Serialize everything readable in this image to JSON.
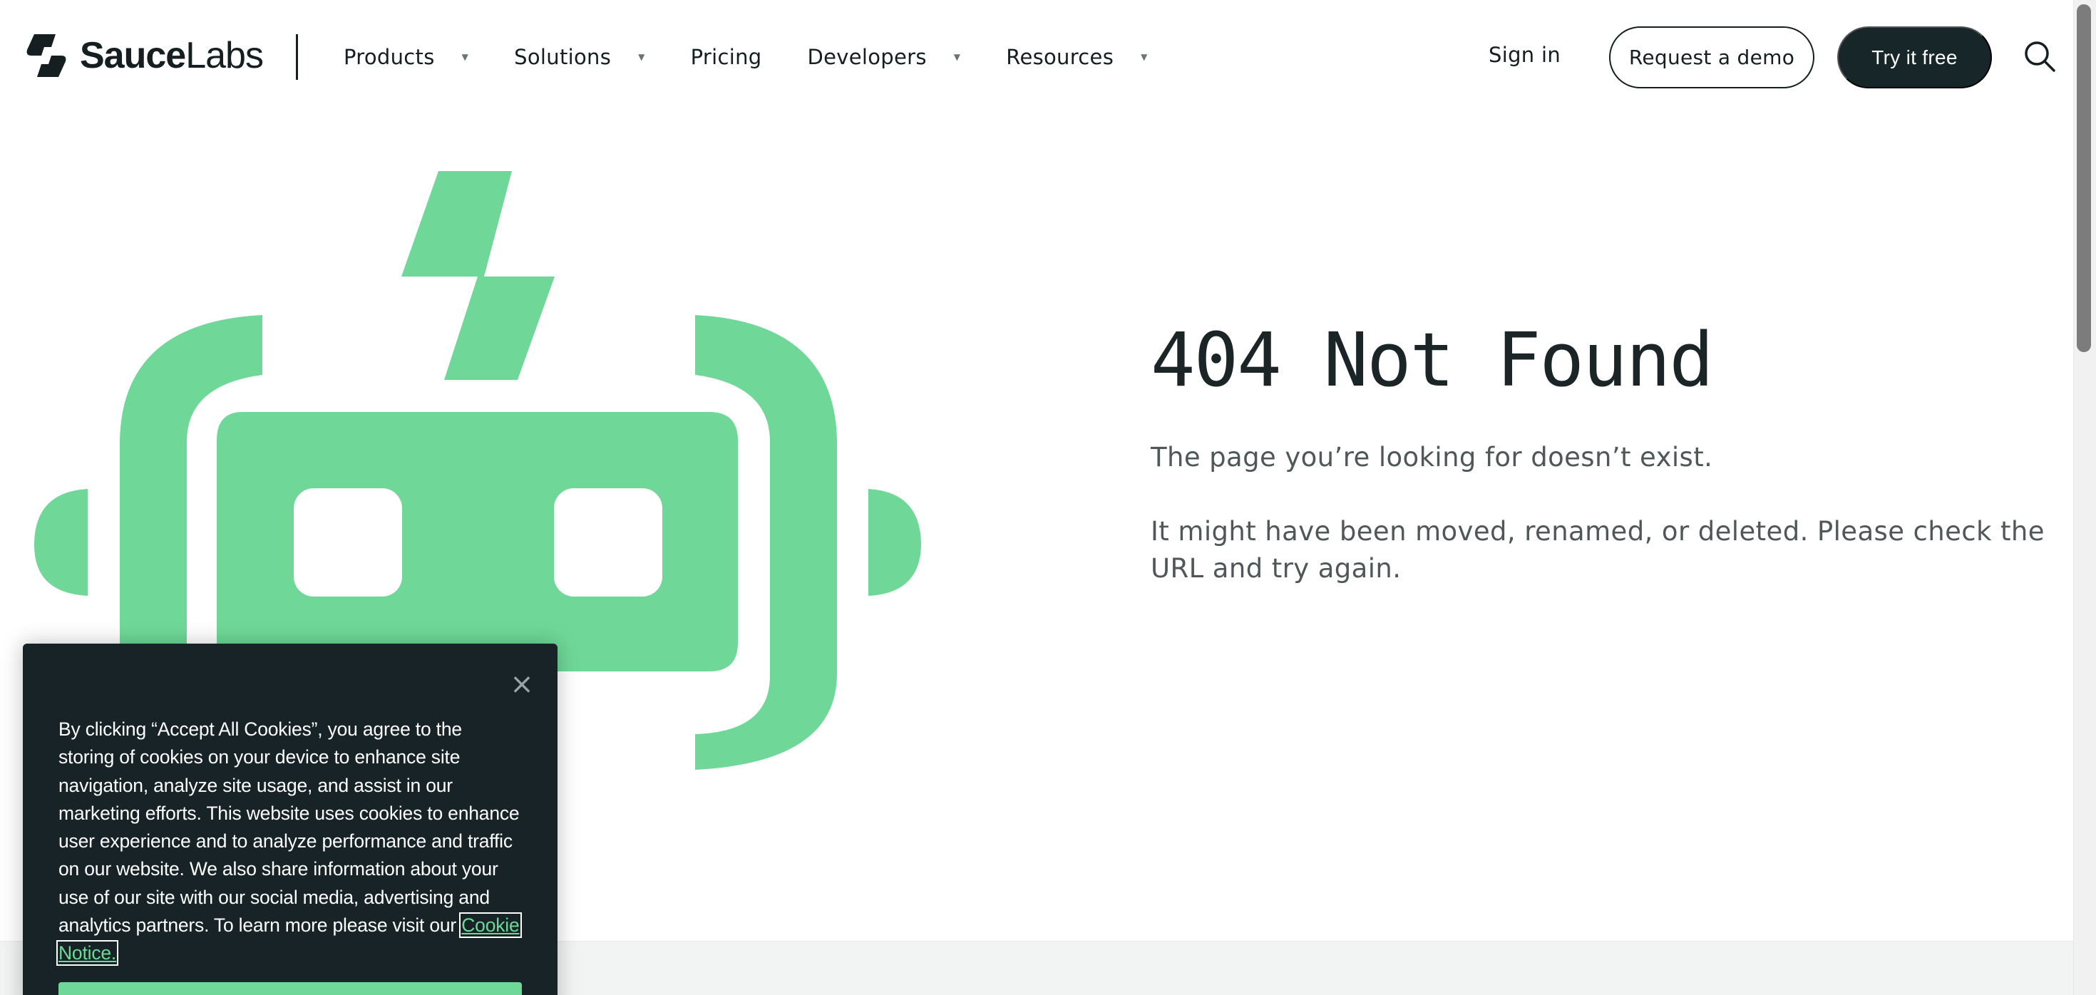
{
  "brand": {
    "name_bold": "Sauce",
    "name_light": "Labs",
    "accent": "#6fd898",
    "dark": "#172628"
  },
  "nav": {
    "items": [
      {
        "label": "Products",
        "has_menu": true
      },
      {
        "label": "Solutions",
        "has_menu": true
      },
      {
        "label": "Pricing",
        "has_menu": false
      },
      {
        "label": "Developers",
        "has_menu": true
      },
      {
        "label": "Resources",
        "has_menu": true
      }
    ],
    "caret": "▼"
  },
  "header": {
    "signin_label": "Sign in",
    "demo_label": "Request a demo",
    "try_label": "Try it free",
    "search_icon": "search-icon"
  },
  "main": {
    "title": "404 Not Found",
    "line1": "The page you’re looking for doesn’t exist.",
    "line2": "It might have been moved, renamed, or deleted. Please check the URL and try again."
  },
  "cookie": {
    "close_glyph": "×",
    "text": "By clicking “Accept All Cookies”, you agree to the storing of cookies on your device to enhance site navigation, analyze site usage, and assist in our marketing efforts. This website uses cookies to enhance user experience and to analyze performance and traffic on our website. We also share information about your use of our site with our social media, advertising and analytics partners. To learn more please visit our",
    "link_label": "Cookie Notice."
  }
}
